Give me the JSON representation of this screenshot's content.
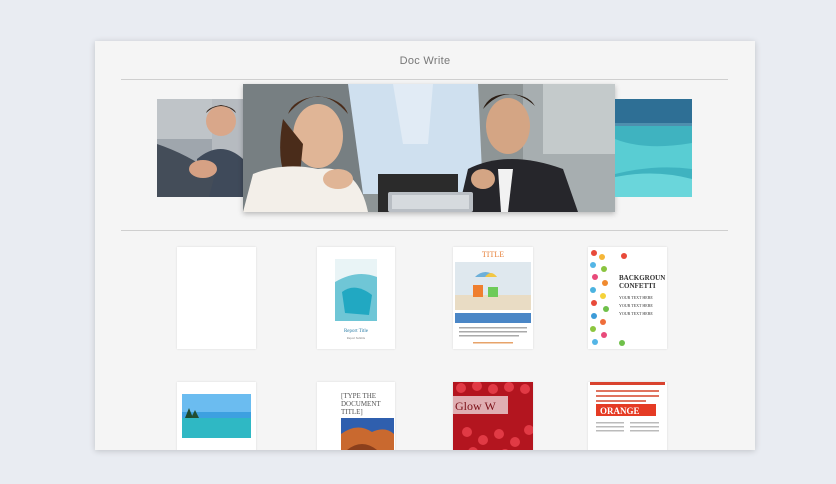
{
  "app": {
    "title": "Doc Write"
  },
  "carousel": {
    "slides": [
      {
        "subject": "business-handshake-photo"
      },
      {
        "subject": "team-with-tablet-photo"
      },
      {
        "subject": "tropical-beach-photo"
      }
    ]
  },
  "templates": {
    "t2": {
      "title": "Report Title",
      "subtitle": "Report Subtitle"
    },
    "t3": {
      "heading": "TITLE"
    },
    "t4": {
      "line1": "BACKGROUN",
      "line2": "CONFETTI",
      "body": [
        "YOUR TEXT HERE",
        "YOUR TEXT HERE",
        "YOUR TEXT HERE"
      ]
    },
    "t6": {
      "line1": "[TYPE THE",
      "line2": "DOCUMENT",
      "line3": "TITLE]"
    },
    "t7": {
      "heading": "Glow W"
    },
    "t8": {
      "heading": "ORANGE"
    }
  }
}
